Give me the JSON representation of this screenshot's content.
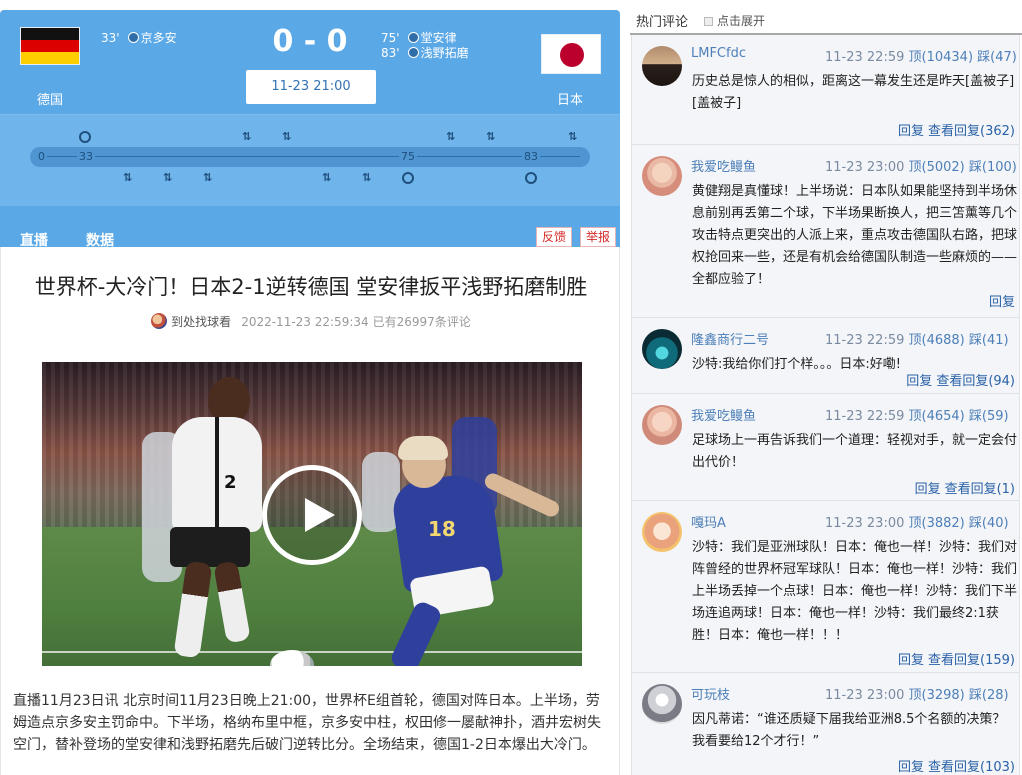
{
  "match": {
    "home_team": "德国",
    "away_team": "日本",
    "score": "0 - 0",
    "kickoff": "11-23 21:00",
    "home_goals": [
      {
        "minute": "33'",
        "player": "京多安"
      }
    ],
    "away_goals": [
      {
        "minute": "75'",
        "player": "堂安律"
      },
      {
        "minute": "83'",
        "player": "浅野拓磨"
      }
    ],
    "timeline_labels": [
      "0",
      "33",
      "75",
      "83"
    ],
    "flag_colors": {
      "de": [
        "#111111",
        "#dd0000",
        "#ffce00"
      ],
      "jp": [
        "#ffffff",
        "#bc002d"
      ]
    }
  },
  "tabs": {
    "live": "直播",
    "data": "数据",
    "feedback": "反馈",
    "report": "举报"
  },
  "article": {
    "headline": "世界杯-大冷门！日本2-1逆转德国 堂安律扳平浅野拓磨制胜",
    "author": "到处找球看",
    "date": "2022-11-23 22:59:34",
    "comment_count": "已有26997条评论",
    "body": "直播11月23日讯 北京时间11月23日晚上21:00，世界杯E组首轮，德国对阵日本。上半场，劳姆造点京多安主罚命中。下半场，格纳布里中框，京多安中柱，权田修一屡献神扑，酒井宏树失空门，替补登场的堂安律和浅野拓磨先后破门逆转比分。全场结束，德国1-2日本爆出大冷门。"
  },
  "sidebar": {
    "title": "热门评论",
    "expand": "点击展开",
    "comments": [
      {
        "user": "LMFCfdc",
        "time": "11-23 22:59",
        "up": "顶(10434)",
        "down": "踩(47)",
        "text": "历史总是惊人的相似，距离这一幕发生还是昨天[盖被子][盖被子]",
        "reply": "回复",
        "view": "查看回复(362)"
      },
      {
        "user": "我爱吃鳗鱼",
        "time": "11-23 23:00",
        "up": "顶(5002)",
        "down": "踩(100)",
        "text": "黄健翔是真懂球！上半场说：日本队如果能坚持到半场休息前别再丢第二个球，下半场果断换人，把三笘薰等几个攻击特点更突出的人派上来，重点攻击德国队右路，把球权抢回来一些，还是有机会给德国队制造一些麻烦的——全都应验了！",
        "reply": "回复",
        "view": ""
      },
      {
        "user": "隆鑫商行二号",
        "time": "11-23 22:59",
        "up": "顶(4688)",
        "down": "踩(41)",
        "text": "沙特:我给你们打个样。。。日本:好嘞!",
        "reply": "回复",
        "view": "查看回复(94)"
      },
      {
        "user": "我爱吃鳗鱼",
        "time": "11-23 22:59",
        "up": "顶(4654)",
        "down": "踩(59)",
        "text": "足球场上一再告诉我们一个道理：轻视对手，就一定会付出代价！",
        "reply": "回复",
        "view": "查看回复(1)"
      },
      {
        "user": "嘎玛A",
        "time": "11-23 23:00",
        "up": "顶(3882)",
        "down": "踩(40)",
        "text": "沙特：我们是亚洲球队！日本：俺也一样！沙特：我们对阵曾经的世界杯冠军球队！日本：俺也一样！沙特：我们上半场丢掉一个点球！日本：俺也一样！沙特：我们下半场连追两球！日本：俺也一样！沙特：我们最终2:1获胜！日本：俺也一样！！！",
        "reply": "回复",
        "view": "查看回复(159)"
      },
      {
        "user": "可玩枝",
        "time": "11-23 23:00",
        "up": "顶(3298)",
        "down": "踩(28)",
        "text": "因凡蒂诺：“谁还质疑下届我给亚洲8.5个名额的决策？我看要给12个才行！”",
        "reply": "回复",
        "view": "查看回复(103)"
      }
    ]
  }
}
